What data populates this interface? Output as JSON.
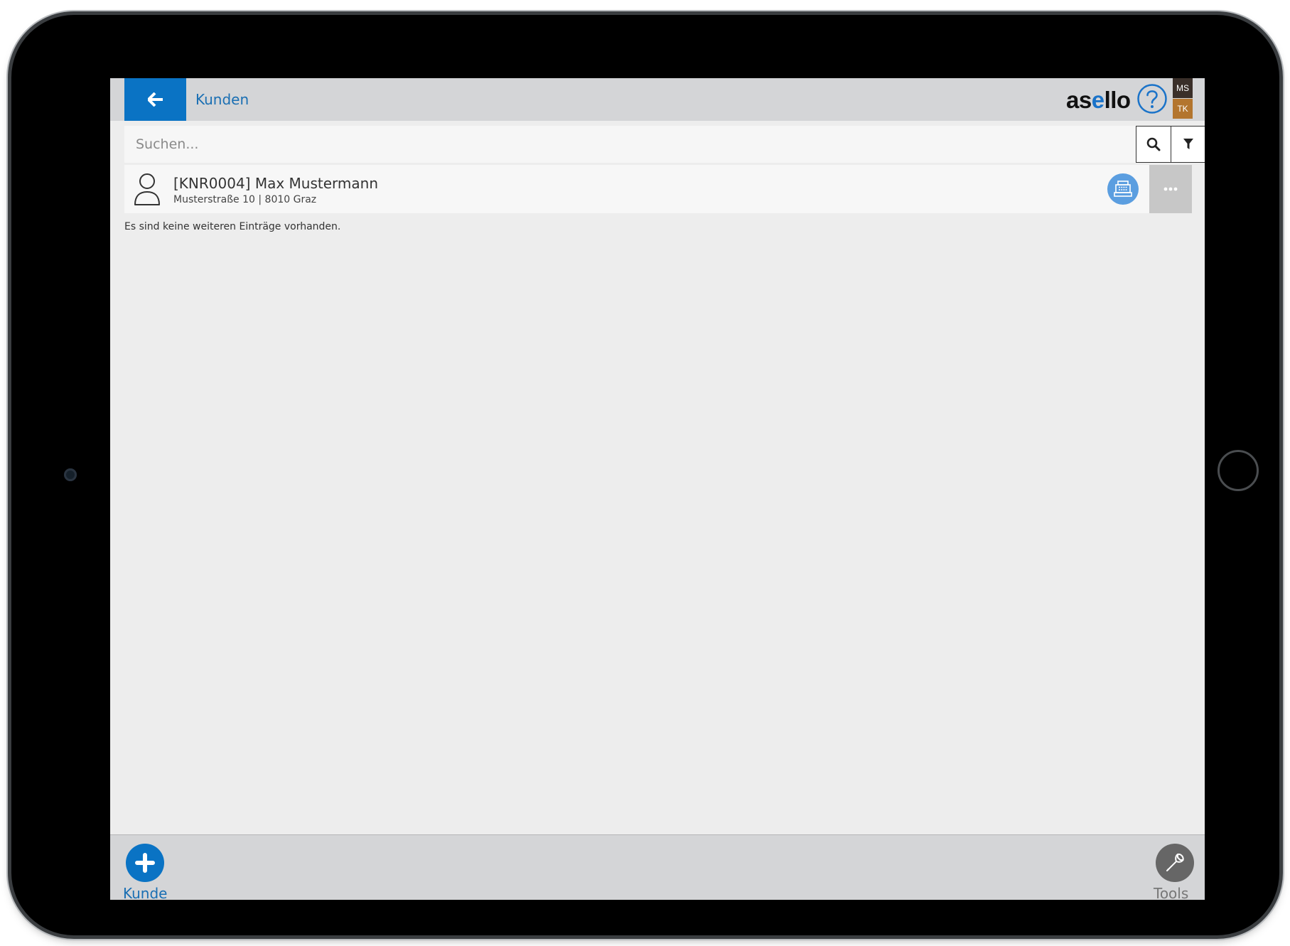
{
  "header": {
    "title": "Kunden",
    "brand": {
      "pre": "as",
      "accent": "e",
      "post": "llo"
    },
    "user_badges": [
      "MS",
      "TK"
    ]
  },
  "search": {
    "placeholder": "Suchen..."
  },
  "customers": [
    {
      "title": "[KNR0004] Max Mustermann",
      "address": "Musterstraße 10 | 8010 Graz"
    }
  ],
  "list_end_message": "Es sind keine weiteren Einträge vorhanden.",
  "footer": {
    "add_label": "Kunde",
    "tools_label": "Tools"
  },
  "colors": {
    "primary": "#0a73c4",
    "header_bg": "#d4d5d7",
    "content_bg": "#ededed",
    "badge_ms": "#3a2f29",
    "badge_tk": "#b3752e"
  }
}
